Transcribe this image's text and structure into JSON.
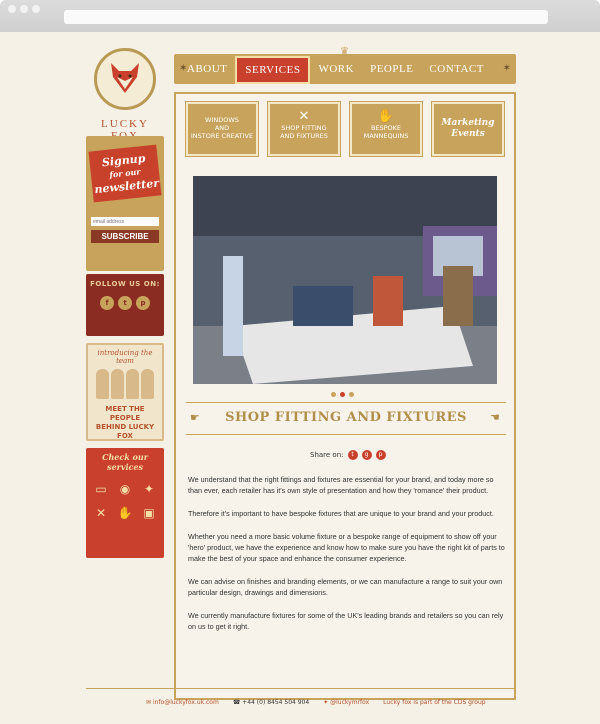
{
  "brand": {
    "name": "LUCKY FOX"
  },
  "nav": {
    "items": [
      {
        "label": "ABOUT"
      },
      {
        "label": "SERVICES"
      },
      {
        "label": "WORK"
      },
      {
        "label": "PEOPLE"
      },
      {
        "label": "CONTACT"
      }
    ],
    "active": "SERVICES"
  },
  "sidebar": {
    "signup": {
      "line1": "Signup",
      "line2": "for our",
      "line3": "newsletter",
      "email_placeholder": "email address",
      "button": "SUBSCRIBE"
    },
    "follow": {
      "title": "FOLLOW US ON:",
      "icons": [
        "facebook-icon",
        "twitter-icon",
        "pinterest-icon"
      ]
    },
    "team": {
      "intro": "introducing the team",
      "cta_line1": "MEET THE PEOPLE",
      "cta_line2": "BEHIND LUCKY FOX"
    },
    "services": {
      "title": "Check our services"
    }
  },
  "tiles": [
    {
      "line1": "WINDOWS",
      "line2": "AND",
      "line3": "INSTORE CREATIVE"
    },
    {
      "line1": "SHOP FITTING",
      "line2": "AND FIXTURES"
    },
    {
      "line1": "BESPOKE",
      "line2": "MANNEQUINS"
    },
    {
      "line1": "Marketing",
      "line2": "Events"
    }
  ],
  "carousel": {
    "slides": 3,
    "active": 2
  },
  "article": {
    "title": "SHOP FITTING AND FIXTURES",
    "share_label": "Share on:",
    "paragraphs": [
      "We understand that the right fittings and fixtures are essential for your brand, and today more so than ever,  each retailer has it's own style of presentation and how they 'romance' their product.",
      "Therefore it's important to have bespoke fixtures that are unique to your brand and your product.",
      "Whether you need a more basic volume fixture or a bespoke range of equipment to show off your 'hero' product, we have the experience and know how to make sure you have the right kit of parts to make the best of your space and enhance the consumer experience.",
      "We can advise on finishes and branding elements, or we can manufacture a range to suit your own particular design, drawings and dimensions.",
      "We currently manufacture fixtures for some of the UK's leading brands and retailers so you can rely on us to get it right."
    ]
  },
  "footer": {
    "email": "info@luckyfox.uk.com",
    "phone": "+44 (0) 8454 504 904",
    "twitter": "@luckymrfox",
    "group": "Lucky fox is part of the CDS group"
  },
  "colors": {
    "gold": "#c8a35c",
    "red": "#c9412d",
    "cream": "#f5f1e6",
    "maroon": "#8a2c22"
  }
}
